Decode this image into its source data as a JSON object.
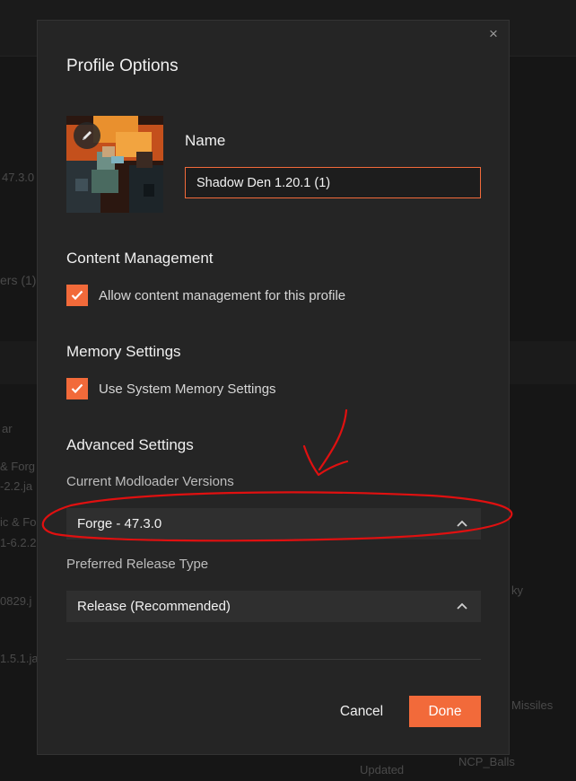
{
  "background": {
    "fragments": [
      "47.3.0",
      "ers (1)",
      "ar",
      "& Forg",
      "-2.2.ja",
      "ic & Fo",
      "1-6.2.2",
      "0829.j",
      "1.5.1.ja",
      "ky",
      "Missiles",
      "Updated",
      "NCP_Balls"
    ]
  },
  "dialog": {
    "title": "Profile Options",
    "close_icon": "close-icon",
    "edit_icon": "pencil-icon",
    "name": {
      "label": "Name",
      "value": "Shadow Den 1.20.1 (1)"
    },
    "content_management": {
      "title": "Content Management",
      "checkbox_label": "Allow content management for this profile",
      "checked": true
    },
    "memory_settings": {
      "title": "Memory Settings",
      "checkbox_label": "Use System Memory Settings",
      "checked": true
    },
    "advanced_settings": {
      "title": "Advanced Settings",
      "modloader_label": "Current Modloader Versions",
      "modloader_value": "Forge - 47.3.0",
      "release_label": "Preferred Release Type",
      "release_value": "Release (Recommended)"
    },
    "buttons": {
      "cancel": "Cancel",
      "done": "Done"
    }
  },
  "colors": {
    "accent": "#f26a3a",
    "dialog_bg": "#252525",
    "select_bg": "#2f2f2f",
    "annotation": "#e01010"
  }
}
